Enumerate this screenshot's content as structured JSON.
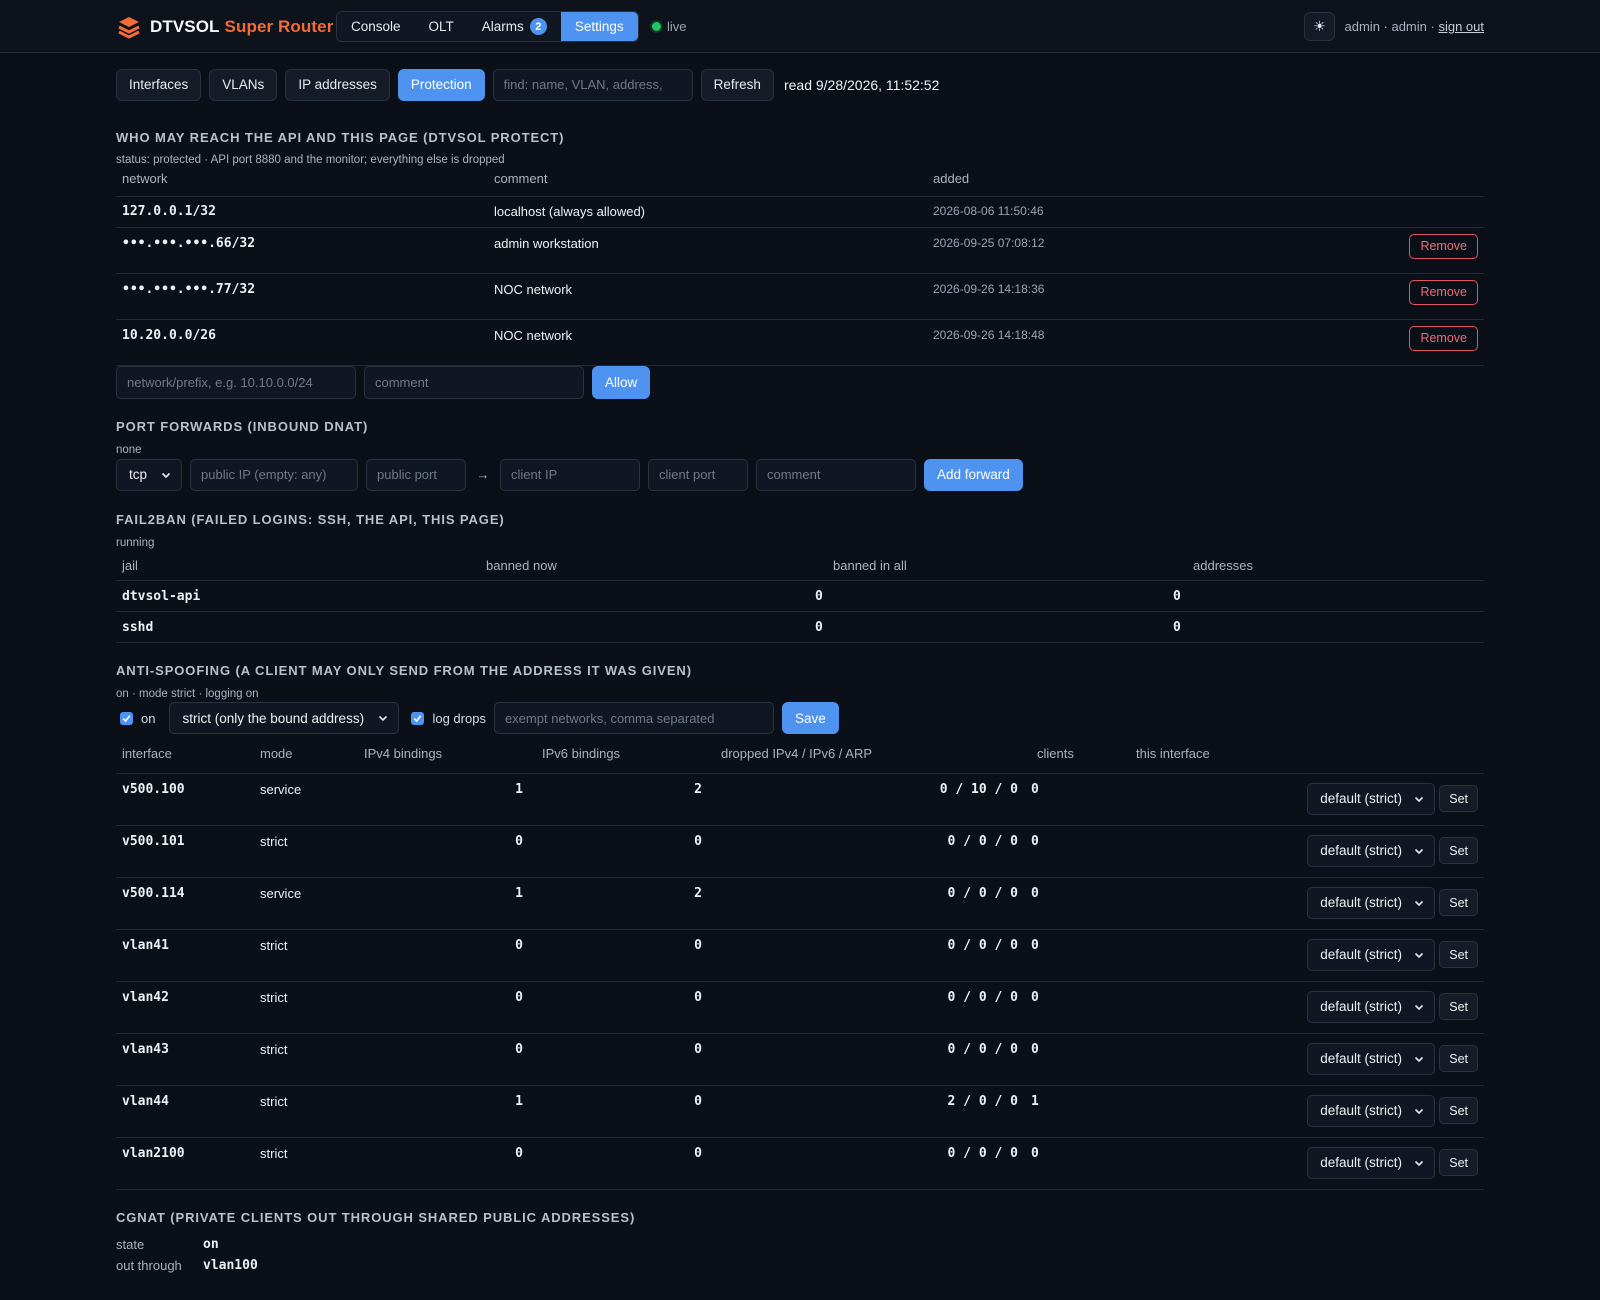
{
  "app": {
    "brand_part1": "DTVSOL",
    "brand_part2": "Super Router",
    "nav": [
      {
        "label": "Console",
        "active": false
      },
      {
        "label": "OLT",
        "active": false
      },
      {
        "label": "Alarms",
        "active": false,
        "badge": "2"
      },
      {
        "label": "Settings",
        "active": true
      }
    ],
    "live_label": "live",
    "theme_icon": "☀",
    "user_text": "admin · admin ·",
    "sign_out": "sign out"
  },
  "toolbar": {
    "tabs": [
      {
        "label": "Interfaces",
        "active": false
      },
      {
        "label": "VLANs",
        "active": false
      },
      {
        "label": "IP addresses",
        "active": false
      },
      {
        "label": "Protection",
        "active": true
      }
    ],
    "search_placeholder": "find: name, VLAN, address,",
    "refresh": "Refresh",
    "read_time": "read 9/28/2026, 11:52:52"
  },
  "protect": {
    "title": "WHO MAY REACH THE API AND THIS PAGE (DTVSOL PROTECT)",
    "status": "status: protected · API port 8880 and the monitor; everything else is dropped",
    "headers": [
      "network",
      "comment",
      "added"
    ],
    "rows": [
      {
        "network": "127.0.0.1/32",
        "comment": "localhost (always allowed)",
        "added": "2026-08-06 11:50:46",
        "removable": false
      },
      {
        "network": "•••.•••.•••.66/32",
        "comment": "admin workstation",
        "added": "2026-09-25 07:08:12",
        "removable": true
      },
      {
        "network": "•••.•••.•••.77/32",
        "comment": "NOC network",
        "added": "2026-09-26 14:18:36",
        "removable": true
      },
      {
        "network": "10.20.0.0/26",
        "comment": "NOC network",
        "added": "2026-09-26 14:18:48",
        "removable": true
      }
    ],
    "remove_label": "Remove",
    "network_placeholder": "network/prefix, e.g. 10.10.0.0/24",
    "comment_placeholder": "comment",
    "allow_label": "Allow"
  },
  "forwards": {
    "title": "PORT FORWARDS (INBOUND DNAT)",
    "status": "none",
    "protocol": "tcp",
    "public_ip_placeholder": "public IP (empty: any)",
    "public_port_placeholder": "public port",
    "arrow": "→",
    "client_ip_placeholder": "client IP",
    "client_port_placeholder": "client port",
    "comment_placeholder": "comment",
    "add_label": "Add forward"
  },
  "fail2ban": {
    "title": "FAIL2BAN (FAILED LOGINS: SSH, THE API, THIS PAGE)",
    "status": "running",
    "headers": [
      "jail",
      "banned now",
      "banned in all",
      "addresses"
    ],
    "rows": [
      {
        "jail": "dtvsol-api",
        "banned_now": "",
        "banned_all": "0",
        "addresses": "0"
      },
      {
        "jail": "sshd",
        "banned_now": "",
        "banned_all": "0",
        "addresses": "0"
      }
    ]
  },
  "antispoof": {
    "title": "ANTI-SPOOFING (A CLIENT MAY ONLY SEND FROM THE ADDRESS IT WAS GIVEN)",
    "status": "on · mode strict · logging on",
    "on_label": "on",
    "mode_value": "strict (only the bound address)",
    "log_label": "log drops",
    "exempt_placeholder": "exempt networks, comma separated",
    "save_label": "Save",
    "headers": [
      "interface",
      "mode",
      "IPv4 bindings",
      "IPv6 bindings",
      "dropped IPv4 / IPv6 / ARP",
      "clients",
      "this interface"
    ],
    "select_value": "default (strict)",
    "set_label": "Set",
    "rows": [
      {
        "iface": "v500.100",
        "mode": "service",
        "ipv4": "1",
        "ipv6": "2",
        "dropped": "0 / 10 / 0",
        "clients": "0"
      },
      {
        "iface": "v500.101",
        "mode": "strict",
        "ipv4": "0",
        "ipv6": "0",
        "dropped": "0 / 0 / 0",
        "clients": "0"
      },
      {
        "iface": "v500.114",
        "mode": "service",
        "ipv4": "1",
        "ipv6": "2",
        "dropped": "0 / 0 / 0",
        "clients": "0"
      },
      {
        "iface": "vlan41",
        "mode": "strict",
        "ipv4": "0",
        "ipv6": "0",
        "dropped": "0 / 0 / 0",
        "clients": "0"
      },
      {
        "iface": "vlan42",
        "mode": "strict",
        "ipv4": "0",
        "ipv6": "0",
        "dropped": "0 / 0 / 0",
        "clients": "0"
      },
      {
        "iface": "vlan43",
        "mode": "strict",
        "ipv4": "0",
        "ipv6": "0",
        "dropped": "0 / 0 / 0",
        "clients": "0"
      },
      {
        "iface": "vlan44",
        "mode": "strict",
        "ipv4": "1",
        "ipv6": "0",
        "dropped": "2 / 0 / 0",
        "clients": "1"
      },
      {
        "iface": "vlan2100",
        "mode": "strict",
        "ipv4": "0",
        "ipv6": "0",
        "dropped": "0 / 0 / 0",
        "clients": "0"
      }
    ]
  },
  "cgnat": {
    "title": "CGNAT (PRIVATE CLIENTS OUT THROUGH SHARED PUBLIC ADDRESSES)",
    "state_key": "state",
    "state_value": "on",
    "out_key": "out through",
    "out_value": "vlan100"
  }
}
